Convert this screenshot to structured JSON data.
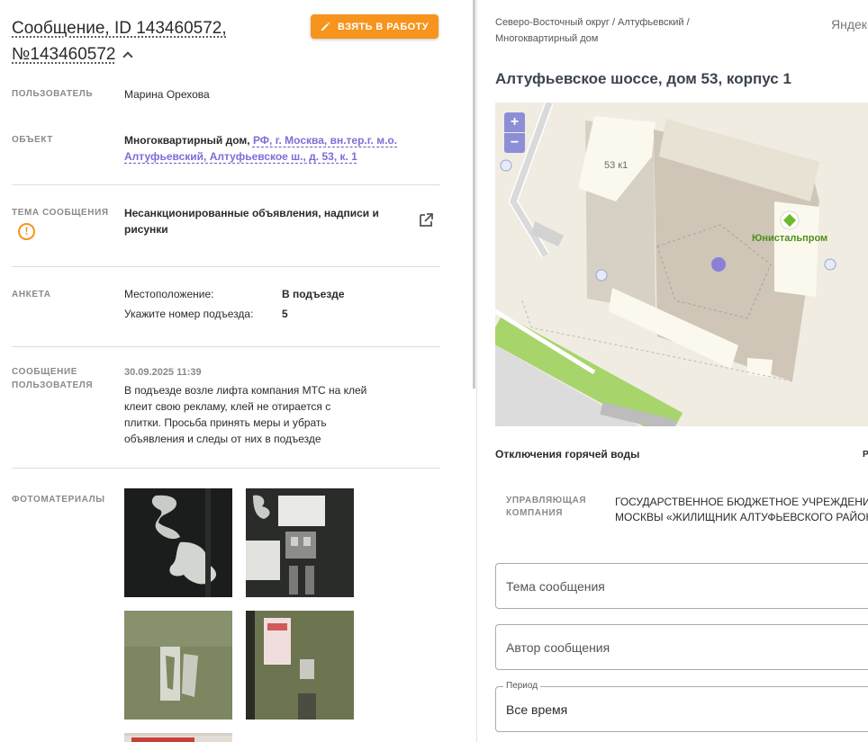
{
  "header": {
    "title": "Сообщение, ID 143460572, №143460572",
    "take_button": "ВЗЯТЬ В РАБОТУ"
  },
  "user": {
    "label": "ПОЛЬЗОВАТЕЛЬ",
    "value": "Марина Орехова"
  },
  "object": {
    "label": "ОБЪЕКТ",
    "type": "Многоквартирный дом,",
    "address_link": "РФ, г. Москва, вн.тер.г. м.о. Алтуфьевский, Алтуфьевское ш., д. 53, к. 1"
  },
  "topic": {
    "label": "ТЕМА СООБЩЕНИЯ",
    "value": "Несанкционированные объявления, надписи и рисунки"
  },
  "questionnaire": {
    "label": "АНКЕТА",
    "rows": [
      {
        "key": "Местоположение:",
        "value": "В подъезде"
      },
      {
        "key": "Укажите номер подъезда:",
        "value": "5"
      }
    ]
  },
  "user_message": {
    "label": "СООБЩЕНИЕ ПОЛЬЗОВАТЕЛЯ",
    "date": "30.09.2025 11:39",
    "text": "В подъезде возле лифта компания МТС на клей клеит свою рекламу, клей не отирается с плитки. Просьба принять меры и убрать объявления и следы от них в подъезде"
  },
  "photos": {
    "label": "ФОТОМАТЕРИАЛЫ"
  },
  "right": {
    "breadcrumb": "Северо-Восточный округ / Алтуфьевский / Многоквартирный дом",
    "yandex": "Яндекс",
    "address_title": "Алтуфьевское шоссе, дом 53, корпус 1",
    "map": {
      "building_label": "53 к1",
      "poi_label": "Юнистальпром",
      "zoom_in": "+",
      "zoom_out": "−"
    },
    "hot_water": "Отключения горячей воды",
    "hot_water_right": "Р",
    "management": {
      "label": "УПРАВЛЯЮЩАЯ КОМПАНИЯ",
      "value_line1": "ГОСУДАРСТВЕННОЕ БЮДЖЕТНОЕ УЧРЕЖДЕНИЕ",
      "value_line2": "МОСКВЫ «ЖИЛИЩНИК АЛТУФЬЕВСКОГО РАЙОН"
    },
    "filters": {
      "topic_placeholder": "Тема сообщения",
      "author_placeholder": "Автор сообщения",
      "period_label": "Период",
      "period_value": "Все время"
    }
  },
  "colors": {
    "accent": "#f7941d",
    "link": "#7b6fd6",
    "map_control": "#8c8fd6",
    "poi": "#6cbb2c"
  }
}
